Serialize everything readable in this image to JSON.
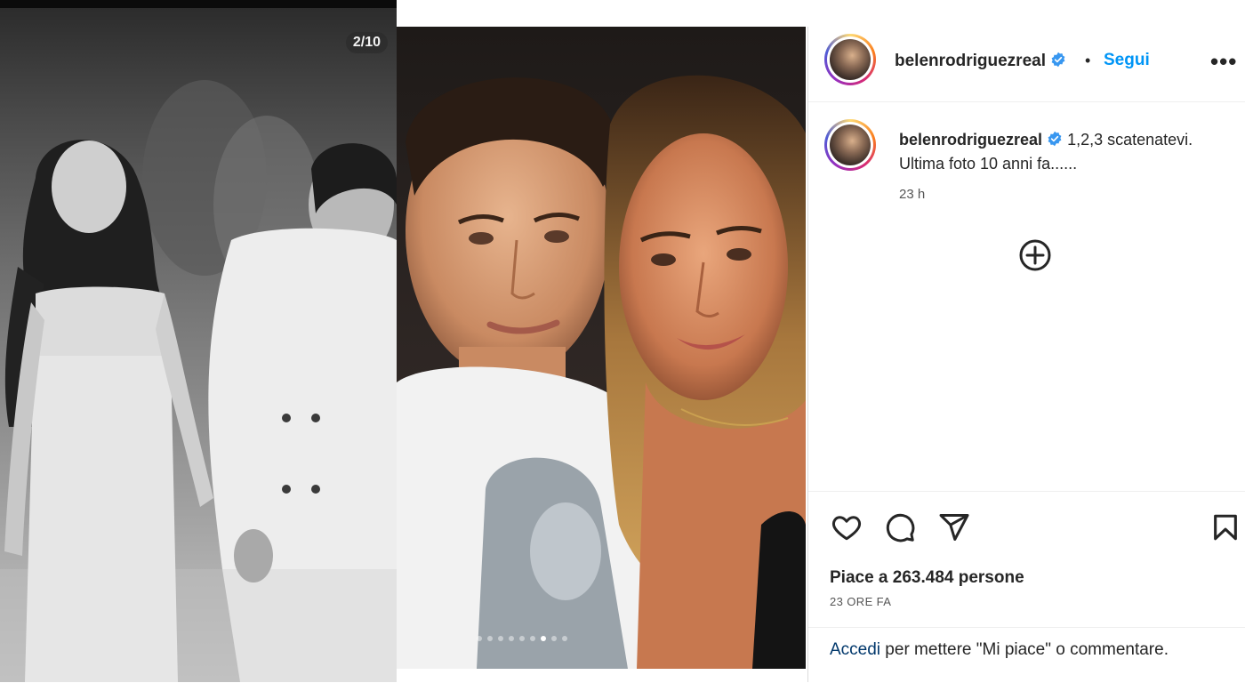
{
  "story": {
    "counter": "2/10"
  },
  "carousel": {
    "dots": 9,
    "active_dot": 7
  },
  "post": {
    "username": "belenrodriguezreal",
    "separator": "•",
    "follow_label": "Segui",
    "more_label": "•••",
    "caption_text": "1,2,3 scatenatevi. Ultima foto 10 anni fa......",
    "caption_time": "23 h",
    "likes_text": "Piace a 263.484 persone",
    "time_ago": "23 ORE FA",
    "login_link": "Accedi",
    "login_rest": " per mettere \"Mi piace\" o commentare."
  },
  "icons": {
    "verified": "verified-badge-icon",
    "add_comment": "plus-circle-icon",
    "like": "heart-icon",
    "comment": "comment-icon",
    "share": "paper-plane-icon",
    "save": "bookmark-icon"
  },
  "colors": {
    "link": "#0095f6",
    "verified": "#3897f0",
    "login_link": "#00376b"
  }
}
